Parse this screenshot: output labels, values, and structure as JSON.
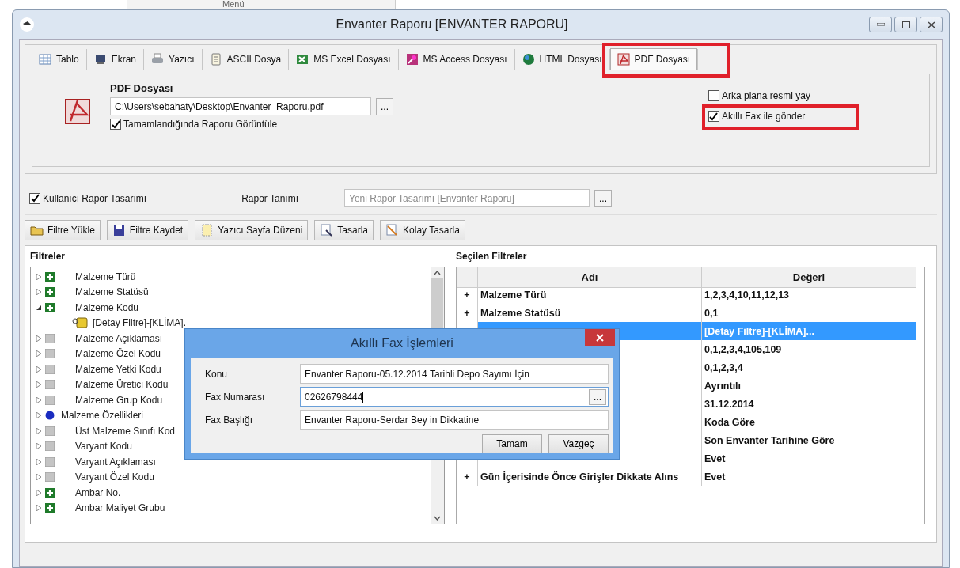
{
  "background_window": {
    "title": "Menü"
  },
  "window": {
    "title": "Envanter Raporu [ENVANTER RAPORU]"
  },
  "output_tabs": [
    {
      "label": "Tablo",
      "kind": "table",
      "selected": false,
      "annotated": false
    },
    {
      "label": "Ekran",
      "kind": "screen",
      "selected": false,
      "annotated": false
    },
    {
      "label": "Yazıcı",
      "kind": "printer",
      "selected": false,
      "annotated": false
    },
    {
      "label": "ASCII Dosya",
      "kind": "text",
      "selected": false,
      "annotated": false
    },
    {
      "label": "MS Excel Dosyası",
      "kind": "excel",
      "selected": false,
      "annotated": false
    },
    {
      "label": "MS Access Dosyası",
      "kind": "access",
      "selected": false,
      "annotated": false
    },
    {
      "label": "HTML Dosyası",
      "kind": "globe",
      "selected": false,
      "annotated": false
    },
    {
      "label": "PDF Dosyası",
      "kind": "pdf",
      "selected": true,
      "annotated": true
    }
  ],
  "pdf_panel": {
    "heading": "PDF Dosyası",
    "path": "C:\\Users\\sebahaty\\Desktop\\Envanter_Raporu.pdf",
    "browse": "...",
    "options": [
      {
        "label": "Tamamlandığında Raporu Görüntüle",
        "checked": true,
        "annotated": false
      }
    ],
    "side_options": [
      {
        "label": "Arka plana resmi yay",
        "checked": false,
        "annotated": false
      },
      {
        "label": "Akıllı Fax ile gönder",
        "checked": true,
        "annotated": true
      }
    ]
  },
  "report_design": {
    "label": "Kullanıcı Rapor Tasarımı",
    "checked": true,
    "definition_label": "Rapor Tanımı",
    "definition_value": "Yeni Rapor Tasarımı [Envanter Raporu]",
    "disabled": true,
    "browse": "..."
  },
  "toolbar": [
    {
      "label": "Filtre Yükle",
      "kind": "open"
    },
    {
      "label": "Filtre Kaydet",
      "kind": "save"
    },
    {
      "label": "Yazıcı Sayfa Düzeni",
      "kind": "page"
    },
    {
      "label": "Tasarla",
      "kind": "design"
    },
    {
      "label": "Kolay Tasarla",
      "kind": "easy"
    }
  ],
  "filters": {
    "title": "Filtreler",
    "items": [
      {
        "label": "Malzeme Türü",
        "kind": "plus",
        "expanded": false
      },
      {
        "label": "Malzeme Statüsü",
        "kind": "plus",
        "expanded": false
      },
      {
        "label": "Malzeme Kodu",
        "kind": "plus",
        "expanded": true,
        "children": [
          {
            "label": "[Detay Filtre]-[KLİMA].",
            "kind": "detail"
          }
        ]
      },
      {
        "label": "Malzeme Açıklaması",
        "kind": "empty",
        "expanded": false
      },
      {
        "label": "Malzeme Özel Kodu",
        "kind": "empty",
        "expanded": false
      },
      {
        "label": "Malzeme Yetki Kodu",
        "kind": "empty",
        "expanded": false
      },
      {
        "label": "Malzeme Üretici Kodu",
        "kind": "empty",
        "expanded": false
      },
      {
        "label": "Malzeme Grup Kodu",
        "kind": "empty",
        "expanded": false
      },
      {
        "label": "Malzeme Özellikleri",
        "kind": "group",
        "expanded": false
      },
      {
        "label": "Üst Malzeme Sınıfı Kod",
        "kind": "empty",
        "expanded": false
      },
      {
        "label": "Varyant Kodu",
        "kind": "empty",
        "expanded": false
      },
      {
        "label": "Varyant Açıklaması",
        "kind": "empty",
        "expanded": false
      },
      {
        "label": "Varyant Özel Kodu",
        "kind": "empty",
        "expanded": false
      },
      {
        "label": "Ambar No.",
        "kind": "plus",
        "expanded": false
      },
      {
        "label": "Ambar Maliyet Grubu",
        "kind": "plus",
        "expanded": false
      }
    ]
  },
  "selected_filters": {
    "title": "Seçilen Filtreler",
    "columns": [
      "Adı",
      "Değeri"
    ],
    "rows": [
      {
        "expander": "+",
        "name": "Malzeme Türü",
        "value": "1,2,3,4,10,11,12,13",
        "selected": false
      },
      {
        "expander": "+",
        "name": "Malzeme Statüsü",
        "value": "0,1",
        "selected": false
      },
      {
        "value": "[Detay Filtre]-[KLİMA]...",
        "selected": true
      },
      {
        "value": "0,1,2,3,4,105,109",
        "selected": false
      },
      {
        "value": "0,1,2,3,4",
        "selected": false
      },
      {
        "value": "Ayrıntılı",
        "selected": false
      },
      {
        "value": "31.12.2014",
        "selected": false
      },
      {
        "value": "Koda Göre",
        "selected": false
      },
      {
        "value": "Son Envanter Tarihine Göre",
        "selected": false
      },
      {
        "value": "Evet",
        "selected": false
      },
      {
        "expander": "+",
        "name": "Gün İçerisinde Önce Girişler Dikkate Alıns",
        "value": "Evet",
        "selected": false
      }
    ]
  },
  "fax_dialog": {
    "title": "Akıllı Fax İşlemleri",
    "fields": [
      {
        "label": "Konu",
        "value": "Envanter Raporu-05.12.2014 Tarihli Depo Sayımı İçin",
        "focused": false
      },
      {
        "label": "Fax Numarası",
        "value": "02626798444",
        "focused": true,
        "browse": "..."
      },
      {
        "label": "Fax Başlığı",
        "value": "Envanter Raporu-Serdar Bey in Dikkatine",
        "focused": false
      }
    ],
    "buttons": [
      "Tamam",
      "Vazgeç"
    ]
  }
}
